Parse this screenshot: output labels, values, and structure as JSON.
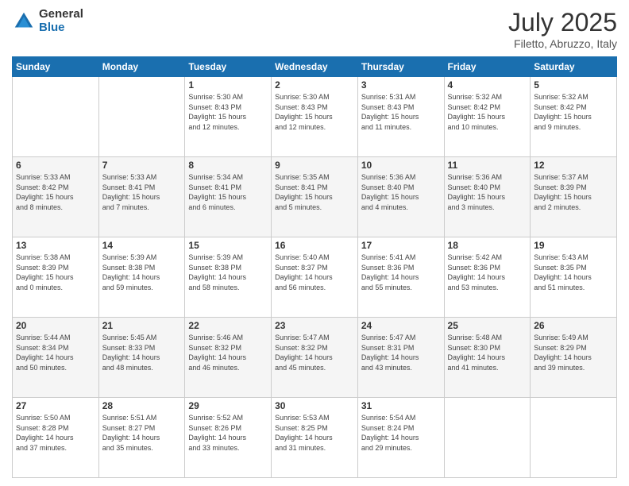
{
  "logo": {
    "general": "General",
    "blue": "Blue"
  },
  "header": {
    "month": "July 2025",
    "location": "Filetto, Abruzzo, Italy"
  },
  "weekdays": [
    "Sunday",
    "Monday",
    "Tuesday",
    "Wednesday",
    "Thursday",
    "Friday",
    "Saturday"
  ],
  "weeks": [
    [
      {
        "day": "",
        "info": ""
      },
      {
        "day": "",
        "info": ""
      },
      {
        "day": "1",
        "info": "Sunrise: 5:30 AM\nSunset: 8:43 PM\nDaylight: 15 hours\nand 12 minutes."
      },
      {
        "day": "2",
        "info": "Sunrise: 5:30 AM\nSunset: 8:43 PM\nDaylight: 15 hours\nand 12 minutes."
      },
      {
        "day": "3",
        "info": "Sunrise: 5:31 AM\nSunset: 8:43 PM\nDaylight: 15 hours\nand 11 minutes."
      },
      {
        "day": "4",
        "info": "Sunrise: 5:32 AM\nSunset: 8:42 PM\nDaylight: 15 hours\nand 10 minutes."
      },
      {
        "day": "5",
        "info": "Sunrise: 5:32 AM\nSunset: 8:42 PM\nDaylight: 15 hours\nand 9 minutes."
      }
    ],
    [
      {
        "day": "6",
        "info": "Sunrise: 5:33 AM\nSunset: 8:42 PM\nDaylight: 15 hours\nand 8 minutes."
      },
      {
        "day": "7",
        "info": "Sunrise: 5:33 AM\nSunset: 8:41 PM\nDaylight: 15 hours\nand 7 minutes."
      },
      {
        "day": "8",
        "info": "Sunrise: 5:34 AM\nSunset: 8:41 PM\nDaylight: 15 hours\nand 6 minutes."
      },
      {
        "day": "9",
        "info": "Sunrise: 5:35 AM\nSunset: 8:41 PM\nDaylight: 15 hours\nand 5 minutes."
      },
      {
        "day": "10",
        "info": "Sunrise: 5:36 AM\nSunset: 8:40 PM\nDaylight: 15 hours\nand 4 minutes."
      },
      {
        "day": "11",
        "info": "Sunrise: 5:36 AM\nSunset: 8:40 PM\nDaylight: 15 hours\nand 3 minutes."
      },
      {
        "day": "12",
        "info": "Sunrise: 5:37 AM\nSunset: 8:39 PM\nDaylight: 15 hours\nand 2 minutes."
      }
    ],
    [
      {
        "day": "13",
        "info": "Sunrise: 5:38 AM\nSunset: 8:39 PM\nDaylight: 15 hours\nand 0 minutes."
      },
      {
        "day": "14",
        "info": "Sunrise: 5:39 AM\nSunset: 8:38 PM\nDaylight: 14 hours\nand 59 minutes."
      },
      {
        "day": "15",
        "info": "Sunrise: 5:39 AM\nSunset: 8:38 PM\nDaylight: 14 hours\nand 58 minutes."
      },
      {
        "day": "16",
        "info": "Sunrise: 5:40 AM\nSunset: 8:37 PM\nDaylight: 14 hours\nand 56 minutes."
      },
      {
        "day": "17",
        "info": "Sunrise: 5:41 AM\nSunset: 8:36 PM\nDaylight: 14 hours\nand 55 minutes."
      },
      {
        "day": "18",
        "info": "Sunrise: 5:42 AM\nSunset: 8:36 PM\nDaylight: 14 hours\nand 53 minutes."
      },
      {
        "day": "19",
        "info": "Sunrise: 5:43 AM\nSunset: 8:35 PM\nDaylight: 14 hours\nand 51 minutes."
      }
    ],
    [
      {
        "day": "20",
        "info": "Sunrise: 5:44 AM\nSunset: 8:34 PM\nDaylight: 14 hours\nand 50 minutes."
      },
      {
        "day": "21",
        "info": "Sunrise: 5:45 AM\nSunset: 8:33 PM\nDaylight: 14 hours\nand 48 minutes."
      },
      {
        "day": "22",
        "info": "Sunrise: 5:46 AM\nSunset: 8:32 PM\nDaylight: 14 hours\nand 46 minutes."
      },
      {
        "day": "23",
        "info": "Sunrise: 5:47 AM\nSunset: 8:32 PM\nDaylight: 14 hours\nand 45 minutes."
      },
      {
        "day": "24",
        "info": "Sunrise: 5:47 AM\nSunset: 8:31 PM\nDaylight: 14 hours\nand 43 minutes."
      },
      {
        "day": "25",
        "info": "Sunrise: 5:48 AM\nSunset: 8:30 PM\nDaylight: 14 hours\nand 41 minutes."
      },
      {
        "day": "26",
        "info": "Sunrise: 5:49 AM\nSunset: 8:29 PM\nDaylight: 14 hours\nand 39 minutes."
      }
    ],
    [
      {
        "day": "27",
        "info": "Sunrise: 5:50 AM\nSunset: 8:28 PM\nDaylight: 14 hours\nand 37 minutes."
      },
      {
        "day": "28",
        "info": "Sunrise: 5:51 AM\nSunset: 8:27 PM\nDaylight: 14 hours\nand 35 minutes."
      },
      {
        "day": "29",
        "info": "Sunrise: 5:52 AM\nSunset: 8:26 PM\nDaylight: 14 hours\nand 33 minutes."
      },
      {
        "day": "30",
        "info": "Sunrise: 5:53 AM\nSunset: 8:25 PM\nDaylight: 14 hours\nand 31 minutes."
      },
      {
        "day": "31",
        "info": "Sunrise: 5:54 AM\nSunset: 8:24 PM\nDaylight: 14 hours\nand 29 minutes."
      },
      {
        "day": "",
        "info": ""
      },
      {
        "day": "",
        "info": ""
      }
    ]
  ]
}
